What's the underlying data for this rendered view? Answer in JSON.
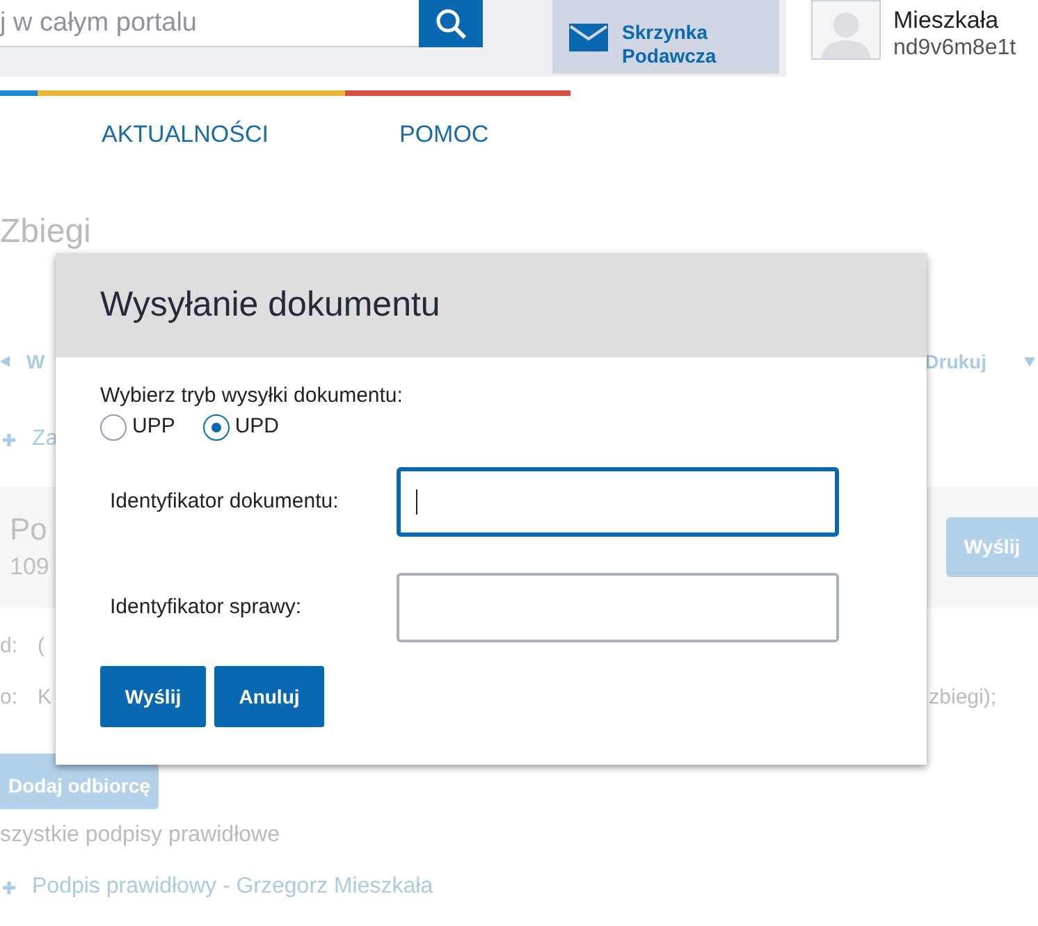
{
  "header": {
    "search": {
      "placeholder": "j w całym portalu"
    },
    "mailbox": {
      "lines": [
        "Skrzynka",
        "Podawcza"
      ]
    },
    "user": {
      "name": "Mieszkała",
      "login": "nd9v6m8e1t"
    }
  },
  "nav": [
    {
      "label": "AKTUALNOŚCI"
    },
    {
      "label": "POMOC"
    }
  ],
  "page": {
    "title": "Zbiegi",
    "toolbar_left": "W",
    "toolbar_right": "Drukuj",
    "add_link": "Za",
    "panel": {
      "title": "Po",
      "number": "109",
      "button": "Wyślij"
    },
    "fields": [
      {
        "label": "d:",
        "value": "("
      },
      {
        "label": "o:",
        "value": "K",
        "tail": "zbiegi);"
      }
    ],
    "add_recipient": "Dodaj odbiorcę",
    "signature_status": "szystkie podpisy prawidłowe",
    "signatures": [
      "Podpis prawidłowy - Grzegorz Mieszkała"
    ]
  },
  "dialog": {
    "title": "Wysyłanie dokumentu",
    "mode_label": "Wybierz tryb wysyłki dokumentu:",
    "modes": [
      {
        "label": "UPP",
        "selected": false
      },
      {
        "label": "UPD",
        "selected": true
      }
    ],
    "inputs": [
      {
        "label": "Identyfikator dokumentu:",
        "focused": true
      },
      {
        "label": "Identyfikator sprawy:",
        "focused": false
      }
    ],
    "buttons": [
      "Wyślij",
      "Anuluj"
    ]
  }
}
